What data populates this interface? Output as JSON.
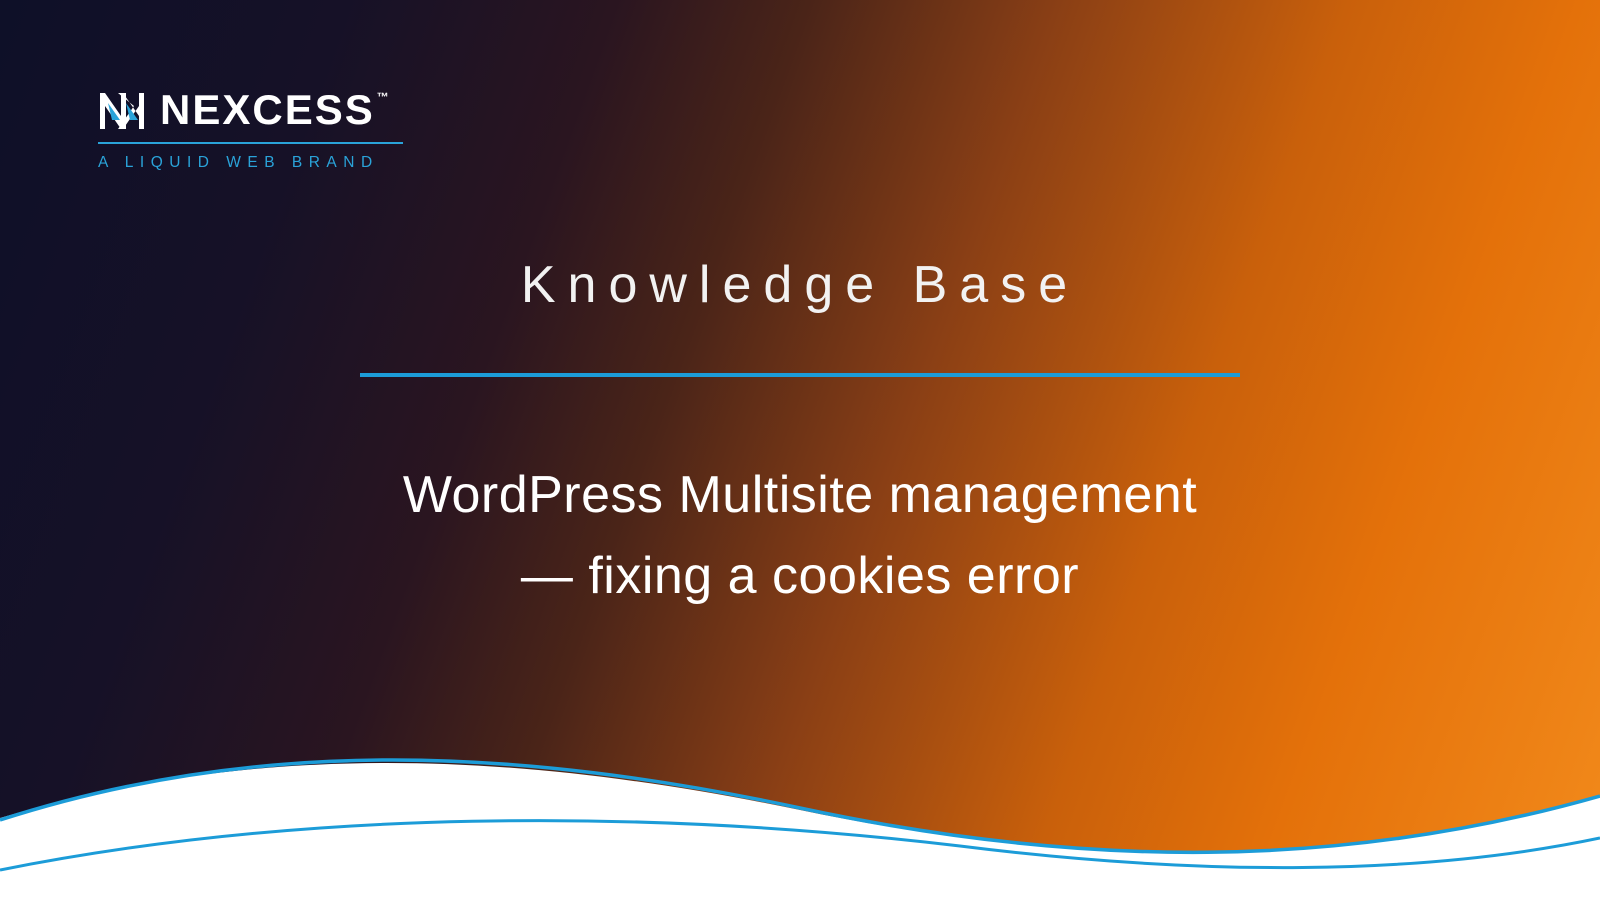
{
  "brand": {
    "name": "NEXCESS",
    "trademark": "™",
    "tagline": "A LIQUID WEB BRAND"
  },
  "category": "Knowledge Base",
  "title_line1": "WordPress Multisite management",
  "title_line2": "— fixing a cookies error",
  "colors": {
    "accent": "#1c9cd8",
    "text": "#ffffff"
  }
}
